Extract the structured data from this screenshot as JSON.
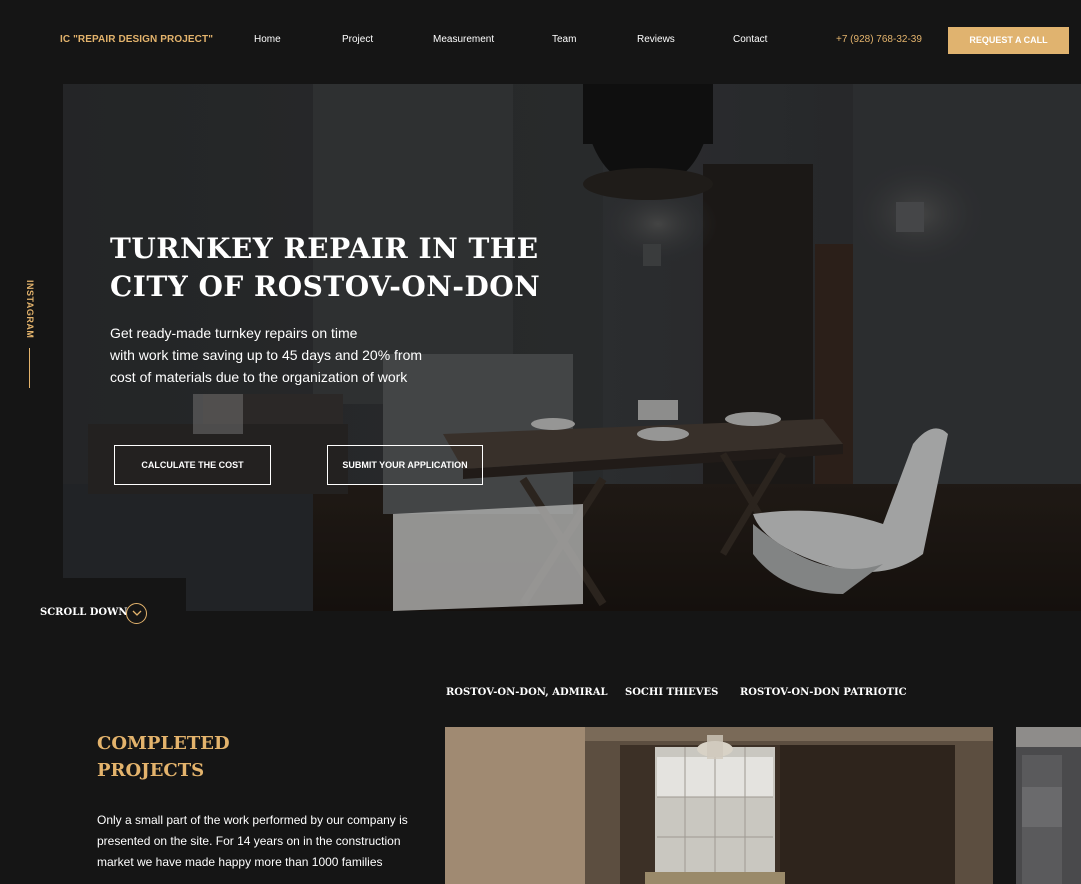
{
  "header": {
    "logo": "IC \"REPAIR DESIGN PROJECT\"",
    "nav": [
      "Home",
      "Project",
      "Measurement",
      "Team",
      "Reviews",
      "Contact"
    ],
    "phone": "+7 (928) 768-32-39",
    "request_button": "REQUEST A CALL"
  },
  "hero": {
    "title_line1": "TURNKEY REPAIR IN THE",
    "title_line2": "CITY OF ROSTOV-ON-DON",
    "subtitle_line1": "Get ready-made turnkey repairs on time",
    "subtitle_line2": "with work time saving up to 45 days and 20% from",
    "subtitle_line3": "cost of materials due to the organization of work",
    "calculate_button": "CALCULATE THE COST",
    "submit_button": "SUBMIT YOUR APPLICATION"
  },
  "side": {
    "instagram": "INSTAGRAM",
    "scroll_down": "SCROLL DOWN"
  },
  "projects": {
    "tabs": [
      "ROSTOV-ON-DON, ADMIRAL",
      "SOCHI THIEVES",
      "ROSTOV-ON-DON PATRIOTIC"
    ],
    "title_line1": "COMPLETED",
    "title_line2": "PROJECTS",
    "description_line1": "Only a small part of the work performed by our company is",
    "description_line2": "presented on the site. For 14 years on in the construction",
    "description_line3": "market we have made happy more than 1000 families"
  },
  "colors": {
    "accent": "#e3b36c",
    "background": "#151515",
    "button": "#e0b36f"
  }
}
